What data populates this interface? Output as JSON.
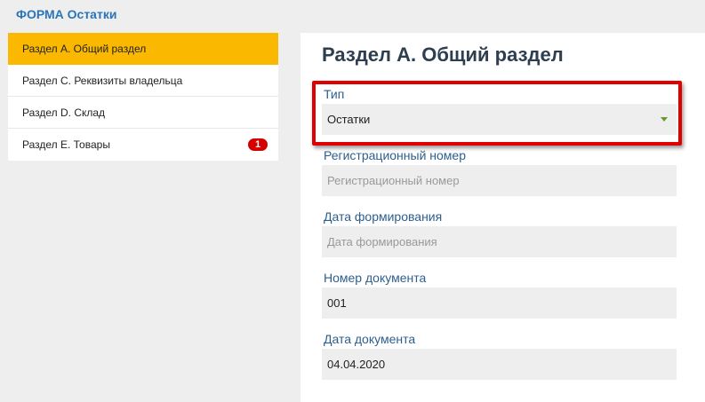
{
  "app": {
    "title": "ФОРМА Остатки"
  },
  "sidebar": {
    "items": [
      {
        "label": "Раздел А. Общий раздел",
        "active": true
      },
      {
        "label": "Раздел С. Реквизиты владельца"
      },
      {
        "label": "Раздел D. Склад"
      },
      {
        "label": "Раздел Е. Товары",
        "badge": "1"
      }
    ]
  },
  "main": {
    "title": "Раздел А. Общий раздел",
    "fields": {
      "type": {
        "label": "Тип",
        "value": "Остатки"
      },
      "reg_number": {
        "label": "Регистрационный номер",
        "placeholder": "Регистрационный номер"
      },
      "formation_date": {
        "label": "Дата формирования",
        "placeholder": "Дата формирования"
      },
      "doc_number": {
        "label": "Номер документа",
        "value": "001"
      },
      "doc_date": {
        "label": "Дата документа",
        "value": "04.04.2020"
      }
    }
  },
  "colors": {
    "accent": "#fbb800",
    "title_blue": "#2a74b8",
    "highlight": "#e00000",
    "badge": "#d40000"
  }
}
